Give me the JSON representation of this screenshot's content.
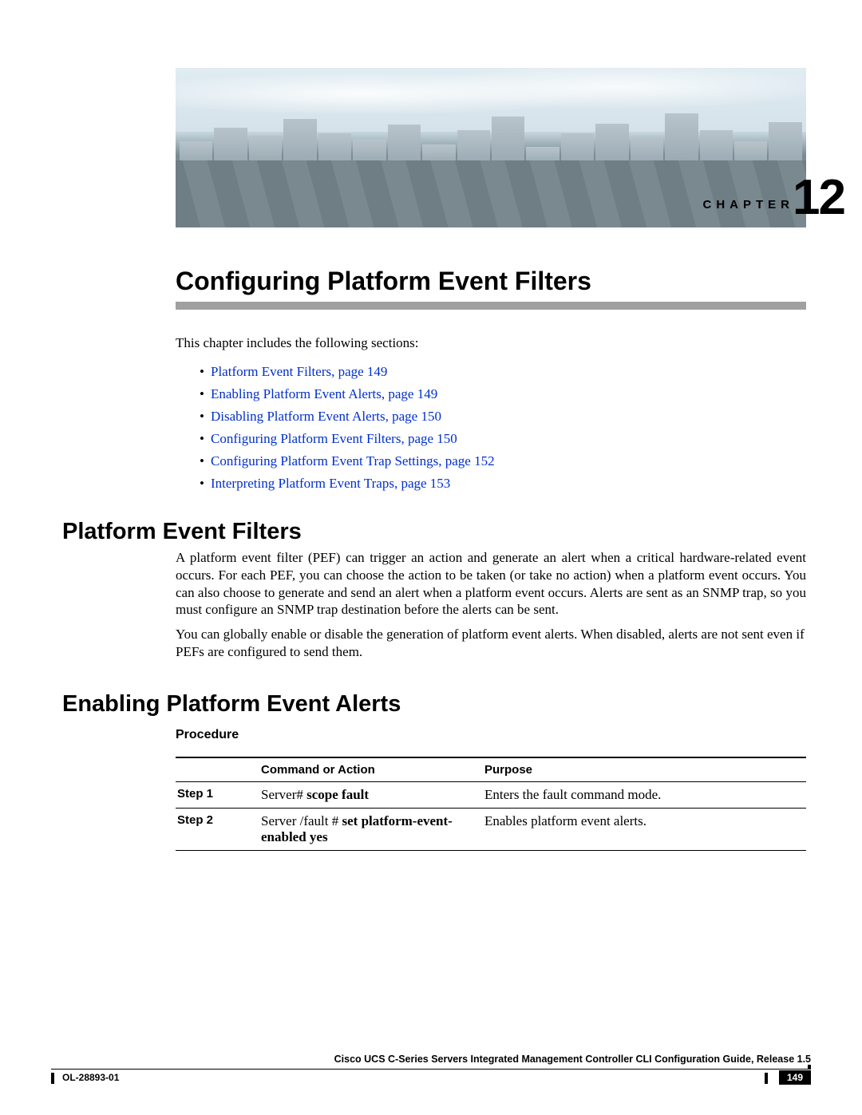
{
  "chapter": {
    "label": "CHAPTER",
    "number": "12",
    "title": "Configuring Platform Event Filters"
  },
  "intro": "This chapter includes the following sections:",
  "toc": [
    "Platform Event Filters, page 149",
    "Enabling Platform Event Alerts, page 149",
    "Disabling Platform Event Alerts, page 150",
    "Configuring Platform Event Filters, page 150",
    "Configuring Platform Event Trap Settings, page 152",
    "Interpreting Platform Event Traps, page 153"
  ],
  "section_pef": {
    "heading": "Platform Event Filters",
    "para1": "A platform event filter (PEF) can trigger an action and generate an alert when a critical hardware-related event occurs. For each PEF, you can choose the action to be taken (or take no action) when a platform event occurs. You can also choose to generate and send an alert when a platform event occurs. Alerts are sent as an SNMP trap, so you must configure an SNMP trap destination before the alerts can be sent.",
    "para2": "You can globally enable or disable the generation of platform event alerts. When disabled, alerts are not sent even if PEFs are configured to send them."
  },
  "section_enable": {
    "heading": "Enabling Platform Event Alerts",
    "procedure_label": "Procedure",
    "table": {
      "head_step": "",
      "head_cmd": "Command or Action",
      "head_purpose": "Purpose",
      "rows": [
        {
          "step": "Step 1",
          "cmd_prefix": "Server# ",
          "cmd_bold": "scope fault",
          "purpose": "Enters the fault command mode."
        },
        {
          "step": "Step 2",
          "cmd_prefix": "Server /fault # ",
          "cmd_bold": "set platform-event-enabled yes",
          "purpose": "Enables platform event alerts."
        }
      ]
    }
  },
  "footer": {
    "guide_title": "Cisco UCS C-Series Servers Integrated Management Controller CLI Configuration Guide, Release 1.5",
    "doc_id": "OL-28893-01",
    "page": "149"
  }
}
